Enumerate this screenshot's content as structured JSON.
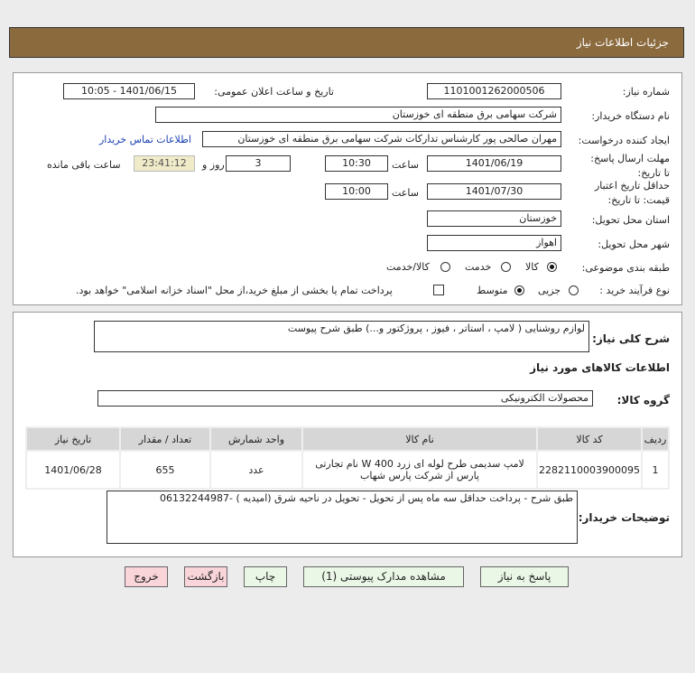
{
  "title": "جزئیات اطلاعات نیاز",
  "fields": {
    "need_number_label": "شماره نیاز:",
    "need_number": "1101001262000506",
    "announce_label": "تاریخ و ساعت اعلان عمومی:",
    "announce_value": "1401/06/15 - 10:05",
    "buyer_org_label": "نام دستگاه خریدار:",
    "buyer_org": "شرکت سهامی برق منطقه ای خوزستان",
    "requester_label": "ایجاد کننده درخواست:",
    "requester": "مهران صالحی پور کارشناس تدارکات شرکت سهامی برق منطقه ای خوزستان",
    "contact_link": "اطلاعات تماس خریدار",
    "deadline_label": "مهلت ارسال پاسخ: تا تاریخ:",
    "deadline_date": "1401/06/19",
    "time_label": "ساعت",
    "deadline_time": "10:30",
    "days": "3",
    "days_label": "روز و",
    "remaining": "23:41:12",
    "remaining_label": "ساعت باقی مانده",
    "validity_label": "حداقل تاریخ اعتبار قیمت: تا تاریخ:",
    "validity_date": "1401/07/30",
    "validity_time": "10:00",
    "province_label": "استان محل تحویل:",
    "province": "خوزستان",
    "city_label": "شهر محل تحویل:",
    "city": "اهواز",
    "category_label": "طبقه بندی موضوعی:",
    "category_options": [
      "کالا",
      "خدمت",
      "کالا/خدمت"
    ],
    "category_selected": "کالا",
    "process_label": "نوع فرآیند خرید :",
    "process_options": [
      "جزیی",
      "متوسط"
    ],
    "process_selected": "متوسط",
    "treasury_text": "پرداخت تمام یا بخشی از مبلغ خرید،از محل \"اسناد خزانه اسلامی\" خواهد بود.",
    "treasury_checked": false
  },
  "summary_label": "شرح کلی نیاز:",
  "summary": "لوازم روشنایی ( لامپ ، استاتر ، فیوز ، پروژکتور و...) طبق شرح پیوست",
  "goods_info_title": "اطلاعات کالاهای مورد نیاز",
  "goods_group_label": "گروه کالا:",
  "goods_group": "محصولات الکترونیکی",
  "table": {
    "headers": [
      "ردیف",
      "کد کالا",
      "نام کالا",
      "واحد شمارش",
      "تعداد / مقدار",
      "تاریخ نیاز"
    ],
    "rows": [
      [
        "1",
        "2282110003900095",
        "لامپ سدیمی طرح لوله ای زرد 400 W نام تجارتی پارس از شرکت پارس شهاب",
        "عدد",
        "655",
        "1401/06/28"
      ]
    ]
  },
  "buyer_notes_label": "توضیحات خریدار:",
  "buyer_notes": "طبق شرح - پرداخت حداقل سه ماه پس از تحویل - تحویل در ناحیه شرق (امیدیه ) -06132244987",
  "buttons": {
    "reply": "پاسخ به نیاز",
    "attachments": "مشاهده مدارک پیوستی (1)",
    "print": "چاپ",
    "back": "بازگشت",
    "exit": "خروج"
  }
}
